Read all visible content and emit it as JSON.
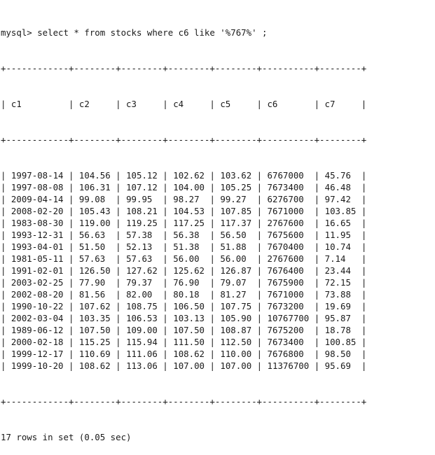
{
  "terminal": {
    "prompt": "mysql> ",
    "command": "select * from stocks where c6 like '%767%' ;",
    "columns": [
      "c1",
      "c2",
      "c3",
      "c4",
      "c5",
      "c6",
      "c7"
    ],
    "rows": [
      [
        "1997-08-14",
        "104.56",
        "105.12",
        "102.62",
        "103.62",
        "6767000",
        "45.76"
      ],
      [
        "1997-08-08",
        "106.31",
        "107.12",
        "104.00",
        "105.25",
        "7673400",
        "46.48"
      ],
      [
        "2009-04-14",
        "99.08",
        "99.95",
        "98.27",
        "99.27",
        "6276700",
        "97.42"
      ],
      [
        "2008-02-20",
        "105.43",
        "108.21",
        "104.53",
        "107.85",
        "7671000",
        "103.85"
      ],
      [
        "1983-08-30",
        "119.00",
        "119.25",
        "117.25",
        "117.37",
        "2767600",
        "16.65"
      ],
      [
        "1993-12-31",
        "56.63",
        "57.38",
        "56.38",
        "56.50",
        "7675600",
        "11.95"
      ],
      [
        "1993-04-01",
        "51.50",
        "52.13",
        "51.38",
        "51.88",
        "7670400",
        "10.74"
      ],
      [
        "1981-05-11",
        "57.63",
        "57.63",
        "56.00",
        "56.00",
        "2767600",
        "7.14"
      ],
      [
        "1991-02-01",
        "126.50",
        "127.62",
        "125.62",
        "126.87",
        "7676400",
        "23.44"
      ],
      [
        "2003-02-25",
        "77.90",
        "79.37",
        "76.90",
        "79.07",
        "7675900",
        "72.15"
      ],
      [
        "2002-08-20",
        "81.56",
        "82.00",
        "80.18",
        "81.27",
        "7671000",
        "73.88"
      ],
      [
        "1990-10-22",
        "107.62",
        "108.75",
        "106.50",
        "107.75",
        "7673200",
        "19.69"
      ],
      [
        "2002-03-04",
        "103.35",
        "106.53",
        "103.13",
        "105.90",
        "10767700",
        "95.87"
      ],
      [
        "1989-06-12",
        "107.50",
        "109.00",
        "107.50",
        "108.87",
        "7675200",
        "18.78"
      ],
      [
        "2000-02-18",
        "115.25",
        "115.94",
        "111.50",
        "112.50",
        "7673400",
        "100.85"
      ],
      [
        "1999-12-17",
        "110.69",
        "111.06",
        "108.62",
        "110.00",
        "7676800",
        "98.50"
      ],
      [
        "1999-10-20",
        "108.62",
        "113.06",
        "107.00",
        "107.00",
        "11376700",
        "95.69"
      ]
    ],
    "summary": "17 rows in set (0.05 sec)"
  }
}
